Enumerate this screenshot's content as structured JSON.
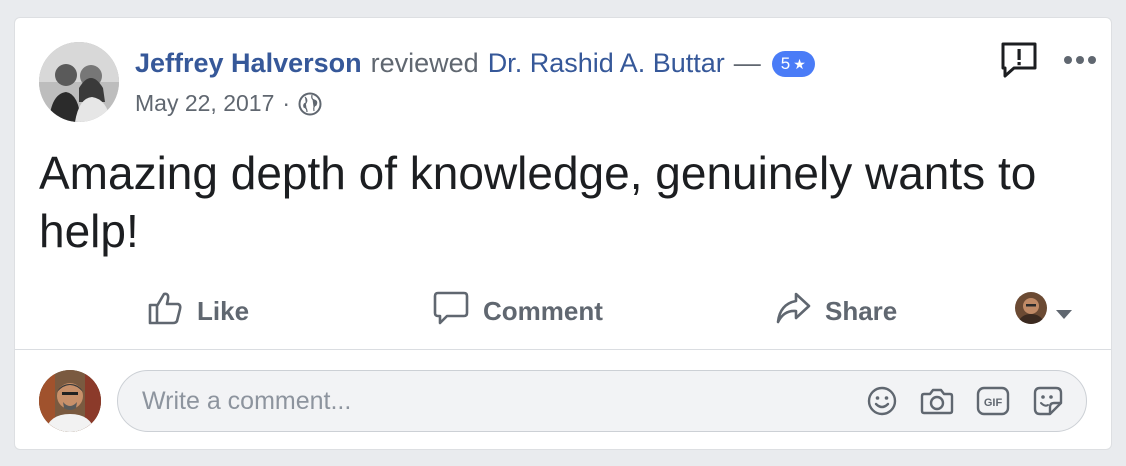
{
  "post": {
    "author": "Jeffrey Halverson",
    "action_text": "reviewed",
    "target": "Dr. Rashid A. Buttar",
    "dash": "—",
    "rating": "5",
    "rating_star": "★",
    "date": "May 22, 2017",
    "separator": "·",
    "audience_icon": "globe-icon",
    "review_text": "Amazing depth of knowledge, genuinely wants to help!"
  },
  "top_actions": {
    "report_icon": "feedback-icon",
    "more_icon": "more-options-icon"
  },
  "actions": {
    "like_label": "Like",
    "comment_label": "Comment",
    "share_label": "Share"
  },
  "comment": {
    "placeholder": "Write a comment...",
    "icons": [
      "emoji-icon",
      "camera-icon",
      "gif-icon",
      "sticker-icon"
    ]
  },
  "colors": {
    "link": "#365899",
    "muted": "#606770",
    "badge": "#4a7cf7",
    "background": "#e9ebee"
  }
}
